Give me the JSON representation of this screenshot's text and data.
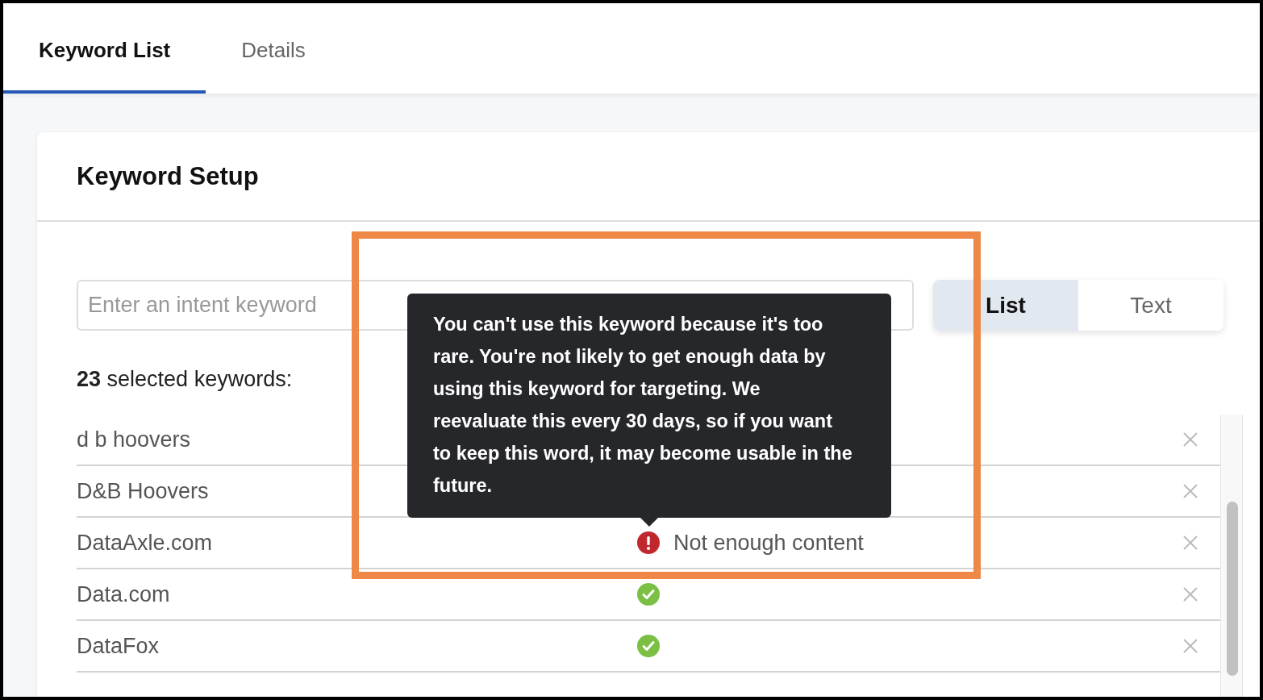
{
  "tabs": [
    {
      "label": "Keyword List",
      "selected": true
    },
    {
      "label": "Details",
      "selected": false
    }
  ],
  "card": {
    "title": "Keyword Setup",
    "input": {
      "placeholder": "Enter an intent keyword"
    },
    "mode_toggle": [
      {
        "label": "List",
        "selected": true
      },
      {
        "label": "Text",
        "selected": false
      }
    ],
    "count": "23",
    "count_label": "selected keywords:",
    "keywords": [
      {
        "name": "d b hoovers",
        "status": {
          "kind": "none"
        }
      },
      {
        "name": "D&B Hoovers",
        "status": {
          "kind": "none"
        }
      },
      {
        "name": "DataAxle.com",
        "status": {
          "kind": "error",
          "text": "Not enough content"
        }
      },
      {
        "name": "Data.com",
        "status": {
          "kind": "ok"
        }
      },
      {
        "name": "DataFox",
        "status": {
          "kind": "ok"
        }
      }
    ],
    "tooltip": "You can't use this keyword because it's too rare. You're not likely to get enough data by using this keyword for targeting. We reevaluate this every 30 days, so if you want to keep this word, it may become usable in the future."
  }
}
